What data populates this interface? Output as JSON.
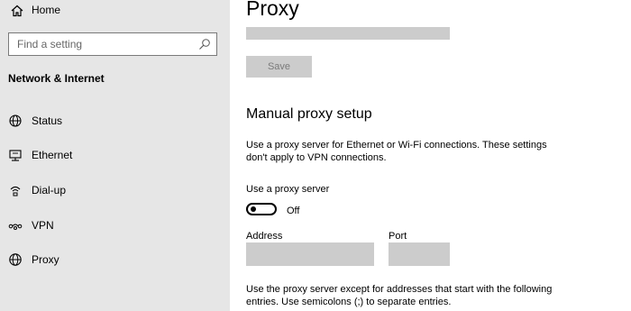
{
  "sidebar": {
    "home_label": "Home",
    "search_placeholder": "Find a setting",
    "section_title": "Network & Internet",
    "items": [
      {
        "label": "Status",
        "icon": "globe-status-icon"
      },
      {
        "label": "Ethernet",
        "icon": "ethernet-icon"
      },
      {
        "label": "Dial-up",
        "icon": "dial-up-icon"
      },
      {
        "label": "VPN",
        "icon": "vpn-icon"
      },
      {
        "label": "Proxy",
        "icon": "globe-icon"
      }
    ]
  },
  "main": {
    "title": "Proxy",
    "save_label": "Save",
    "manual_heading": "Manual proxy setup",
    "manual_description": "Use a proxy server for Ethernet or Wi-Fi connections. These settings don't apply to VPN connections.",
    "use_proxy_label": "Use a proxy server",
    "toggle_state": "Off",
    "address_label": "Address",
    "port_label": "Port",
    "exception_note": "Use the proxy server except for addresses that start with the following entries. Use semicolons (;) to separate entries."
  }
}
